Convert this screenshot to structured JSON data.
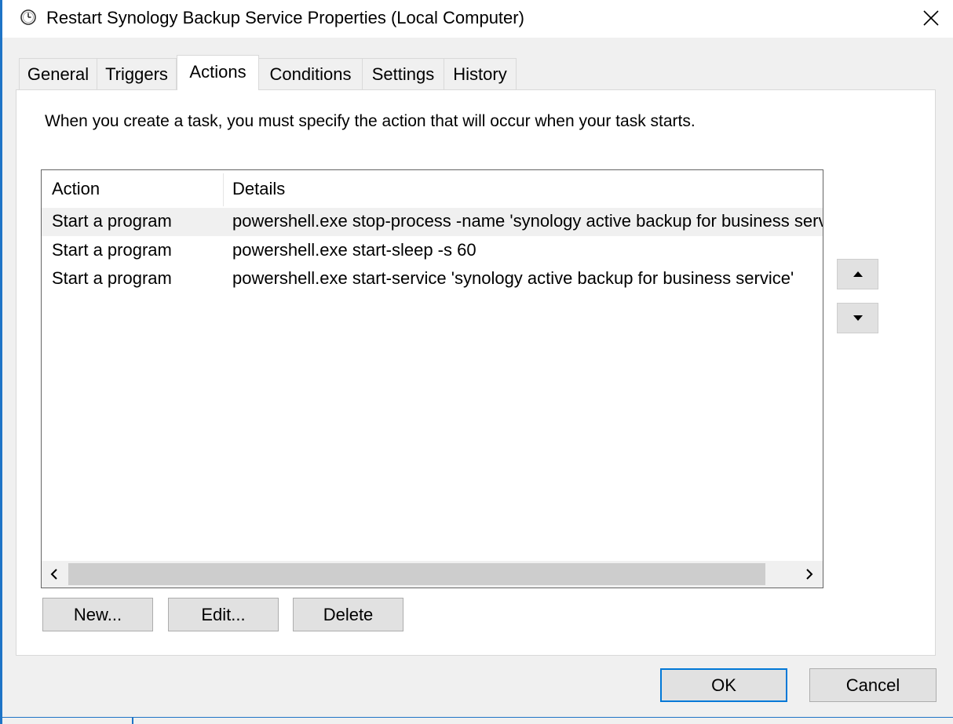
{
  "window": {
    "title": "Restart Synology Backup Service Properties (Local Computer)",
    "icon": "clock-icon",
    "close_icon": "close-icon"
  },
  "tabs": [
    {
      "label": "General",
      "active": false
    },
    {
      "label": "Triggers",
      "active": false
    },
    {
      "label": "Actions",
      "active": true
    },
    {
      "label": "Conditions",
      "active": false
    },
    {
      "label": "Settings",
      "active": false
    },
    {
      "label": "History",
      "active": false
    }
  ],
  "actions_tab": {
    "intro": "When you create a task, you must specify the action that will occur when your task starts.",
    "columns": [
      "Action",
      "Details"
    ],
    "rows": [
      {
        "action": "Start a program",
        "details": "powershell.exe stop-process -name 'synology active backup for business service'",
        "selected": true
      },
      {
        "action": "Start a program",
        "details": "powershell.exe start-sleep -s 60",
        "selected": false
      },
      {
        "action": "Start a program",
        "details": "powershell.exe start-service 'synology active backup for business service'",
        "selected": false
      }
    ],
    "buttons": {
      "new": "New...",
      "edit": "Edit...",
      "delete": "Delete"
    },
    "move_up_icon": "triangle-up-icon",
    "move_down_icon": "triangle-down-icon"
  },
  "footer": {
    "ok": "OK",
    "cancel": "Cancel"
  },
  "colors": {
    "accent": "#0078d7",
    "selection": "#f0f0f0",
    "window_border": "#1e74c6"
  }
}
